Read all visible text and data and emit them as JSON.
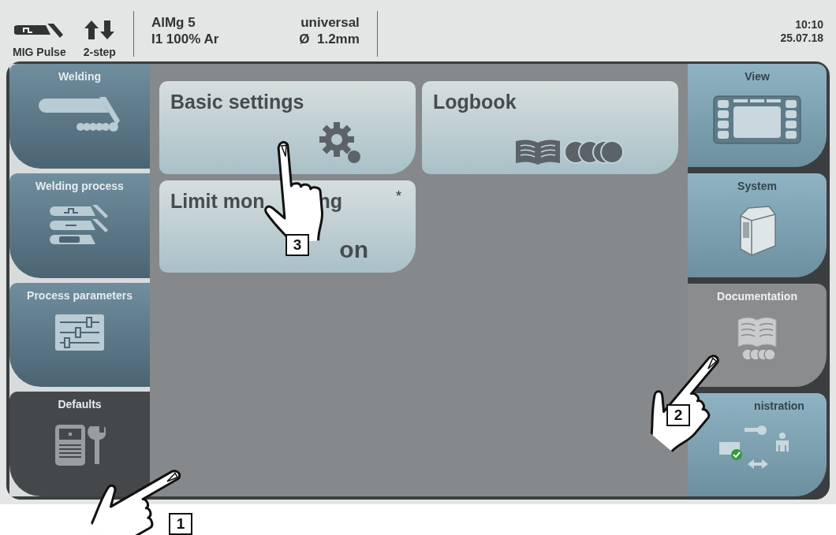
{
  "status_bar": {
    "process": "MIG Pulse",
    "mode": "2-step",
    "material": "AlMg 5",
    "gas": "I1 100% Ar",
    "characteristic": "universal",
    "wire": "Ø  1.2mm",
    "time": "10:10",
    "date": "25.07.18"
  },
  "left_menu": [
    {
      "label": "Welding",
      "selected": false
    },
    {
      "label": "Welding process",
      "selected": false
    },
    {
      "label": "Process parameters",
      "selected": false
    },
    {
      "label": "Defaults",
      "selected": true
    }
  ],
  "tiles": [
    {
      "title": "Basic settings"
    },
    {
      "title": "Logbook"
    },
    {
      "title": "Limit mon",
      "title_tail": "ng",
      "value": "on",
      "marker": "*"
    }
  ],
  "right_menu": [
    {
      "label": "View",
      "selected": false
    },
    {
      "label": "System",
      "selected": false
    },
    {
      "label": "Documentation",
      "selected": true
    },
    {
      "label": "nistration",
      "selected": false
    }
  ],
  "callouts": [
    "3",
    "2",
    "1"
  ]
}
